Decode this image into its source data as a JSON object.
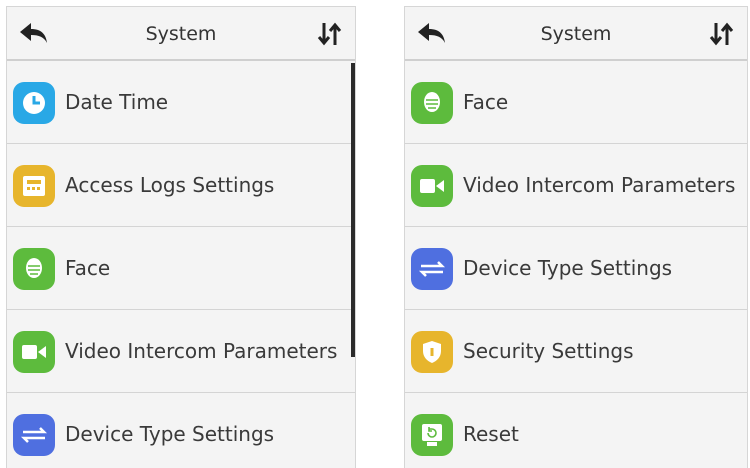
{
  "left_screen": {
    "header": {
      "title": "System",
      "back_icon": "back-arrow-icon",
      "sort_icon": "sort-icon"
    },
    "items": [
      {
        "label": "Date Time",
        "icon": "clock-icon",
        "color": "#29a8e6"
      },
      {
        "label": "Access Logs Settings",
        "icon": "log-icon",
        "color": "#e7b52c"
      },
      {
        "label": "Face",
        "icon": "face-icon",
        "color": "#5dbb3d"
      },
      {
        "label": "Video Intercom Parameters",
        "icon": "video-icon",
        "color": "#5dbb3d"
      },
      {
        "label": "Device Type Settings",
        "icon": "swap-icon",
        "color": "#4f6fe0"
      }
    ]
  },
  "right_screen": {
    "header": {
      "title": "System",
      "back_icon": "back-arrow-icon",
      "sort_icon": "sort-icon"
    },
    "items": [
      {
        "label": "Face",
        "icon": "face-icon",
        "color": "#5dbb3d"
      },
      {
        "label": "Video Intercom Parameters",
        "icon": "video-icon",
        "color": "#5dbb3d"
      },
      {
        "label": "Device Type Settings",
        "icon": "swap-icon",
        "color": "#4f6fe0"
      },
      {
        "label": "Security Settings",
        "icon": "shield-icon",
        "color": "#e7b52c"
      },
      {
        "label": "Reset",
        "icon": "reset-icon",
        "color": "#5dbb3d"
      }
    ]
  }
}
